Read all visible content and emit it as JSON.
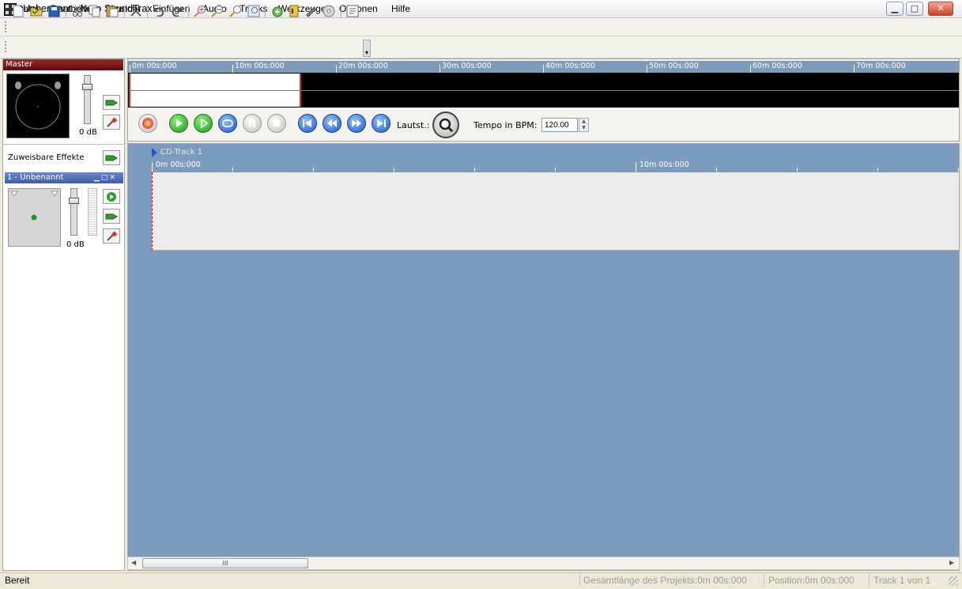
{
  "window": {
    "title": "Unbenannt - Nero SoundTrax",
    "minimize": "▁",
    "maximize": "□",
    "close": "✕"
  },
  "menu": [
    "Datei",
    "Bearbeiten",
    "Ansicht",
    "Einfügen",
    "Audio",
    "Tracks",
    "Werkzeuge",
    "Optionen",
    "Hilfe"
  ],
  "toolbar": {
    "icons": [
      "new-icon",
      "open-icon",
      "save-icon",
      "cut-icon",
      "copy-icon",
      "paste-icon",
      "delete-icon",
      "undo-icon",
      "redo-icon",
      "zoom-in-icon",
      "zoom-out-icon",
      "zoom-fit-icon",
      "zoom-selection-icon",
      "add-track-icon",
      "add-audio-icon",
      "add-effect-icon",
      "add-cd-icon",
      "properties-icon"
    ]
  },
  "master": {
    "header": "Master",
    "level": "0 dB"
  },
  "assignable": {
    "label": "Zuweisbare Effekte"
  },
  "channel": {
    "header": "1 - Unbenannt",
    "level": "0 dB"
  },
  "overview_ruler": [
    "0m 00s:000",
    "10m 00s:000",
    "20m 00s:000",
    "30m 00s:000",
    "40m 00s:000",
    "50m 00s:000",
    "60m 00s:000",
    "70m 00s:000"
  ],
  "transport": {
    "buttons": [
      "record-button",
      "play-button",
      "play-from-cursor-button",
      "loop-button",
      "pause-button",
      "stop-button",
      "goto-start-button",
      "rewind-button",
      "fast-forward-button",
      "goto-end-button"
    ],
    "volume_label": "Lautst.:",
    "tempo_label": "Tempo in BPM:",
    "tempo_value": "120.00"
  },
  "timeline": {
    "track_name": "CD-Track 1",
    "ruler": [
      "0m 00s:000",
      "10m 00s:000"
    ]
  },
  "scrollbar": {
    "left_arrow": "◀",
    "right_arrow": "▶",
    "grip": "III"
  },
  "status": {
    "ready": "Bereit",
    "total_length": "Gesamtlänge des Projekts:0m 00s:000",
    "position": "Position:0m 00s:000",
    "track": "Track 1 von 1"
  },
  "colors": {
    "accent": "#1b58c8",
    "master_header": "#8b1a1a",
    "channel_header": "#4a68b0",
    "timeline_bg": "#7b9bbf"
  }
}
